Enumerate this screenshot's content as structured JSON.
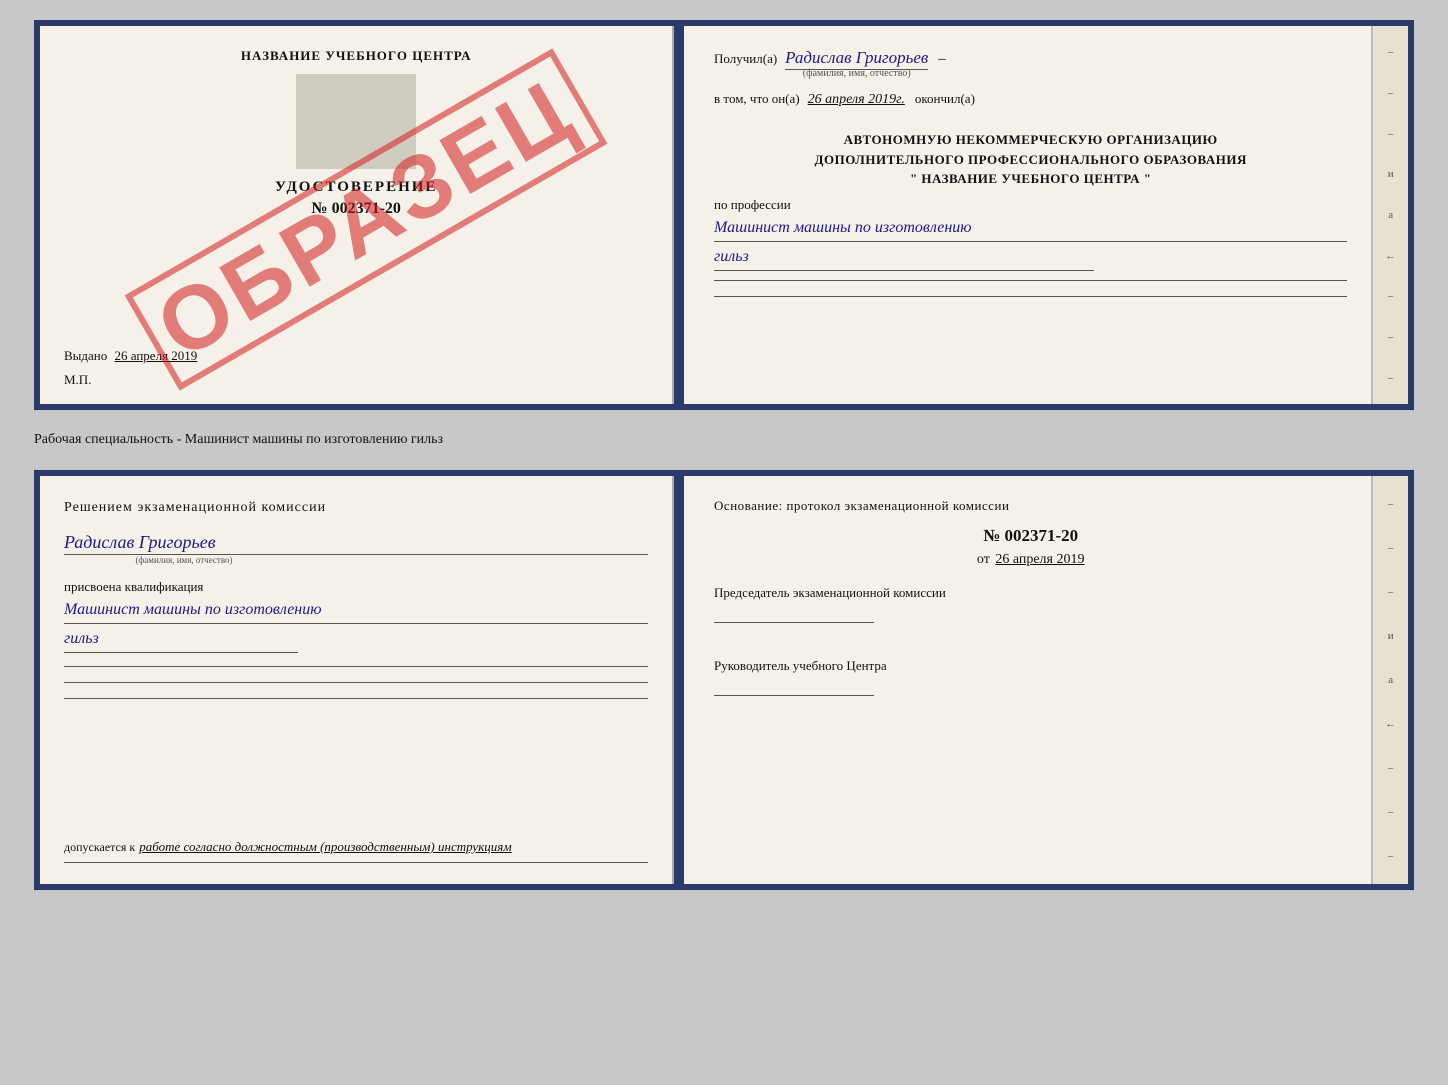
{
  "top": {
    "left": {
      "title": "НАЗВАНИЕ УЧЕБНОГО ЦЕНТРА",
      "cert_label": "УДОСТОВЕРЕНИЕ",
      "cert_number": "№ 002371-20",
      "issued_label": "Выдано",
      "issued_date": "26 апреля 2019",
      "mp_label": "М.П.",
      "watermark": "ОБРАЗЕЦ"
    },
    "right": {
      "received_label": "Получил(а)",
      "received_name": "Радислав Григорьев",
      "name_subtext": "(фамилия, имя, отчество)",
      "in_that_label": "в том, что он(а)",
      "date_value": "26 апреля 2019г.",
      "finished_label": "окончил(а)",
      "org_line1": "АВТОНОМНУЮ НЕКОММЕРЧЕСКУЮ ОРГАНИЗАЦИЮ",
      "org_line2": "ДОПОЛНИТЕЛЬНОГО ПРОФЕССИОНАЛЬНОГО ОБРАЗОВАНИЯ",
      "org_line3": "\" НАЗВАНИЕ УЧЕБНОГО ЦЕНТРА \"",
      "profession_label": "по профессии",
      "profession_line1": "Машинист машины по изготовлению",
      "profession_line2": "гильз"
    }
  },
  "separator": {
    "text": "Рабочая специальность - Машинист машины по изготовлению гильз"
  },
  "bottom": {
    "left": {
      "title": "Решением  экзаменационной  комиссии",
      "person_name": "Радислав Григорьев",
      "name_subtext": "(фамилия, имя, отчество)",
      "assigned_label": "присвоена квалификация",
      "qualification_line1": "Машинист машины по изготовлению",
      "qualification_line2": "гильз",
      "allowed_label": "допускается к",
      "allowed_value": "работе согласно должностным (производственным) инструкциям"
    },
    "right": {
      "osnov_label": "Основание: протокол экзаменационной комиссии",
      "protocol_number": "№  002371-20",
      "date_prefix": "от",
      "date_value": "26 апреля 2019",
      "chairman_label": "Председатель экзаменационной комиссии",
      "head_label": "Руководитель учебного Центра"
    }
  },
  "spine": {
    "dashes": [
      "–",
      "–",
      "–",
      "и",
      "а",
      "←",
      "–",
      "–",
      "–"
    ]
  }
}
